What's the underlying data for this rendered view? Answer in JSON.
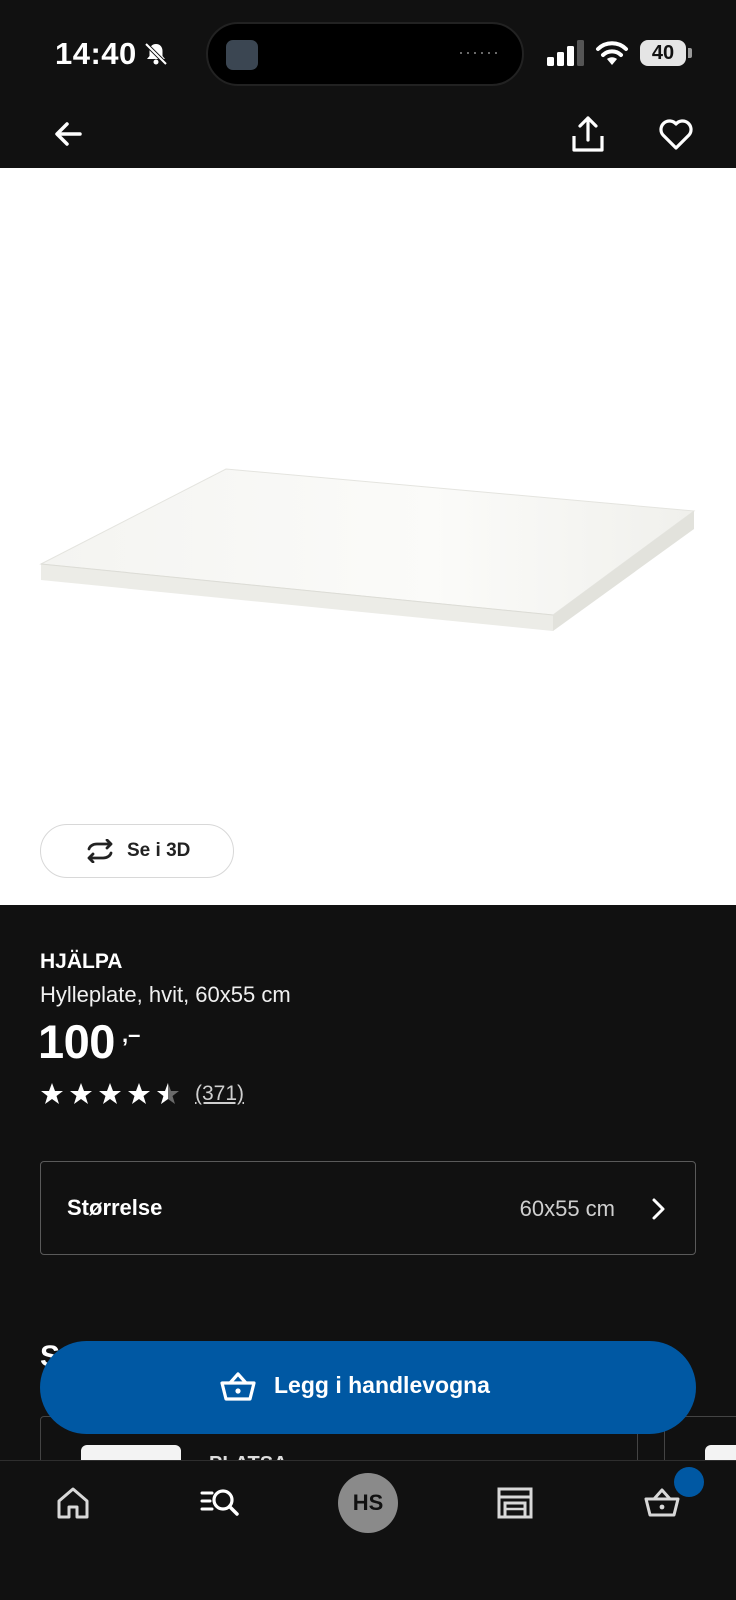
{
  "status_bar": {
    "time": "14:40",
    "battery": "40",
    "island_dots": "······"
  },
  "nav": {
    "back_icon": "arrow-left-icon",
    "share_icon": "share-icon",
    "favorite_icon": "heart-icon"
  },
  "image": {
    "view_3d_label": "Se i 3D"
  },
  "product": {
    "brand": "HJÄLPA",
    "description": "Hylleplate, hvit, 60x55 cm",
    "price": "100",
    "price_suffix": ",–",
    "rating": 4.5,
    "rating_max": 5,
    "review_count": "(371)"
  },
  "size": {
    "label": "Størrelse",
    "value": "60x55 cm"
  },
  "peek": {
    "section_initial": "S",
    "card_title": "PLATSA"
  },
  "cta": {
    "label": "Legg i handlevogna"
  },
  "tabbar": {
    "profile_initials": "HS",
    "items": [
      "home-icon",
      "search-list-icon",
      "profile-avatar",
      "store-icon",
      "cart-icon"
    ]
  },
  "colors": {
    "background": "#111111",
    "accent": "#0058a3",
    "image_bg": "#ffffff"
  }
}
